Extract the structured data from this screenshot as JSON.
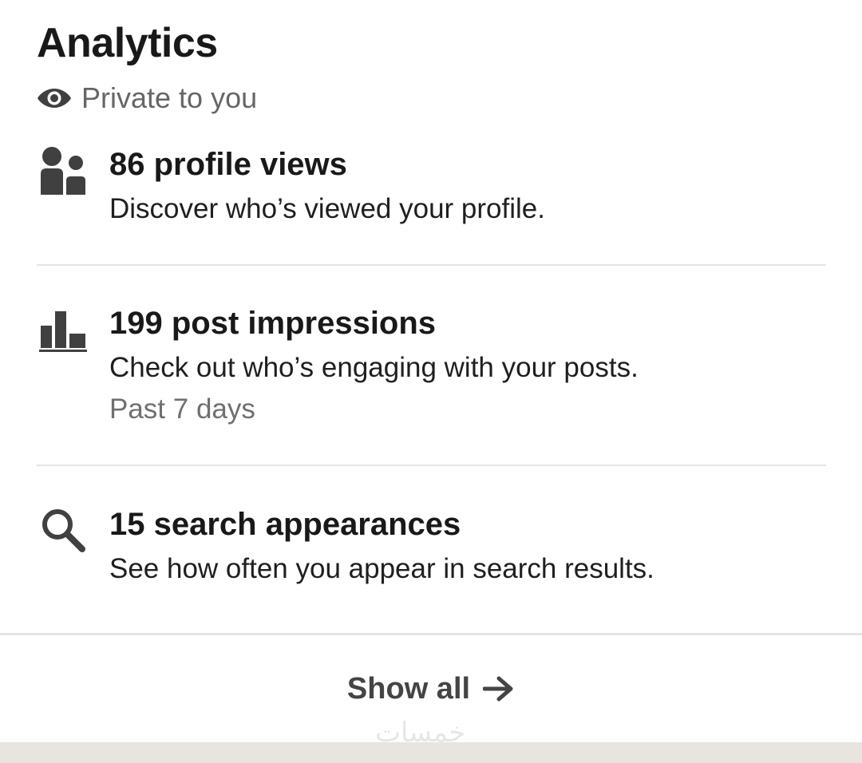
{
  "header": {
    "title": "Analytics",
    "privacy_label": "Private to you"
  },
  "items": [
    {
      "icon": "people-icon",
      "title": "86 profile views",
      "description": "Discover who’s viewed your profile."
    },
    {
      "icon": "bar-chart-icon",
      "title": "199 post impressions",
      "description": "Check out who’s engaging with your posts.",
      "meta": "Past 7 days"
    },
    {
      "icon": "search-icon",
      "title": "15 search appearances",
      "description": "See how often you appear in search results."
    }
  ],
  "footer": {
    "show_all_label": "Show all"
  },
  "watermark": "خمسات",
  "colors": {
    "text_primary": "#191919",
    "text_secondary": "#666666",
    "icon": "#404040",
    "divider": "#e5e5e5",
    "footer_band": "#e8e5df"
  }
}
